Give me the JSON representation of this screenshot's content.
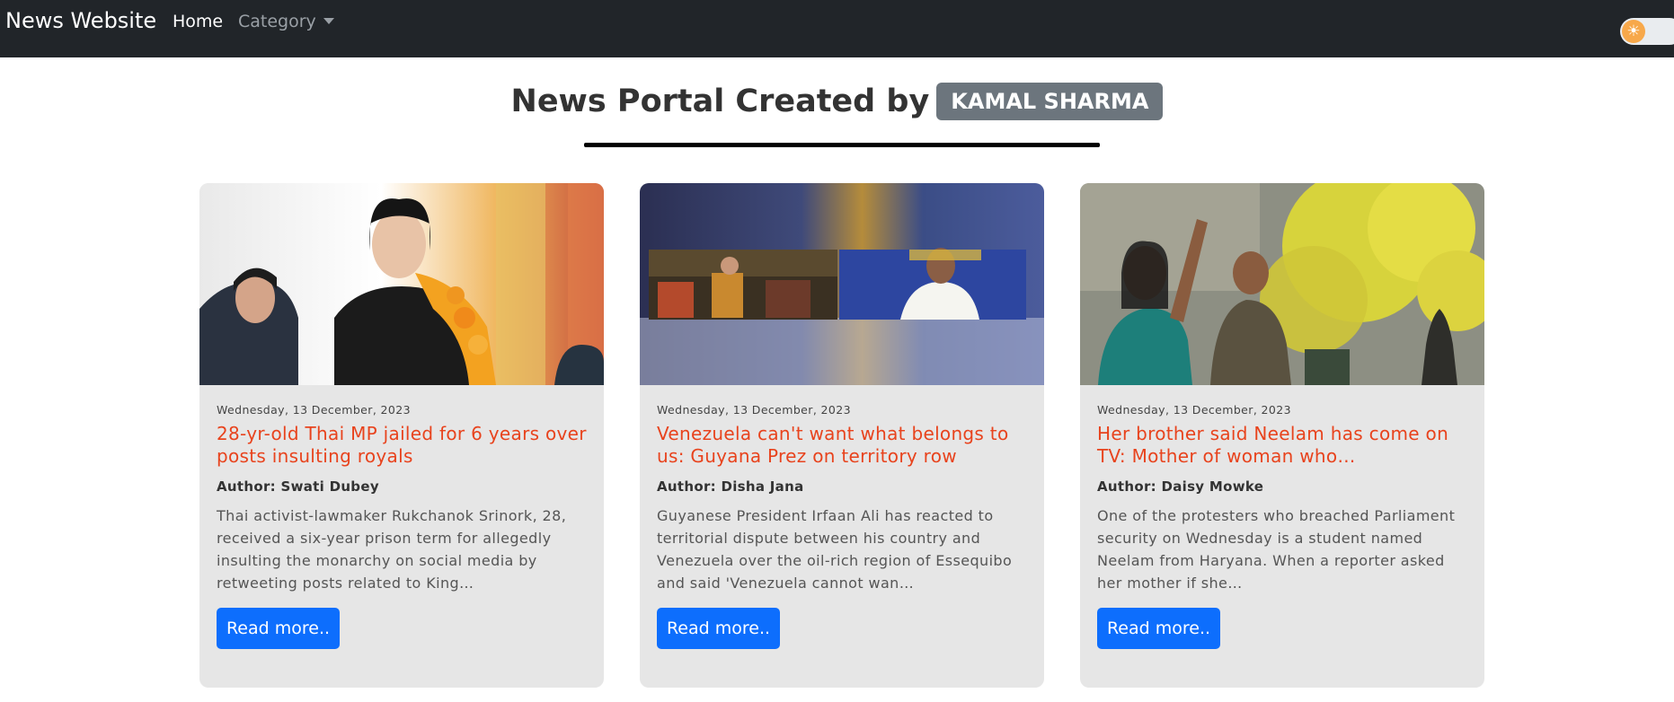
{
  "navbar": {
    "brand": "News Website",
    "links": [
      {
        "label": "Home"
      },
      {
        "label": "Category"
      }
    ]
  },
  "theme_toggle": {
    "icon": "sun-icon",
    "state": "light"
  },
  "header": {
    "title": "News Portal Created by",
    "badge": "KAMAL SHARMA"
  },
  "colors": {
    "navbar_bg": "#212529",
    "card_bg": "#e6e6e6",
    "title_color": "#e8431d",
    "button_bg": "#0d6efd",
    "badge_bg": "#6c757d"
  },
  "cards": [
    {
      "date": "Wednesday, 13 December, 2023",
      "title": "28-yr-old Thai MP jailed for 6 years over posts insulting royals",
      "author": "Author: Swati Dubey",
      "description": "Thai activist-lawmaker Rukchanok Srinork, 28, received a six-year prison term for allegedly insulting the monarchy on social media by retweeting posts related to King…",
      "button": "Read more.."
    },
    {
      "date": "Wednesday, 13 December, 2023",
      "title": "Venezuela can't want what belongs to us: Guyana Prez on territory row",
      "author": "Author: Disha Jana",
      "description": "Guyanese President Irfaan Ali has reacted to territorial dispute between his country and Venezuela over the oil-rich region of Essequibo and said 'Venezuela cannot wan…",
      "button": "Read more.."
    },
    {
      "date": "Wednesday, 13 December, 2023",
      "title": "Her brother said Neelam has come on TV: Mother of woman who…",
      "author": "Author: Daisy Mowke",
      "description": "One of the protesters who breached Parliament security on Wednesday is a student named Neelam from Haryana. When a reporter asked her mother if she…",
      "button": "Read more.."
    }
  ]
}
